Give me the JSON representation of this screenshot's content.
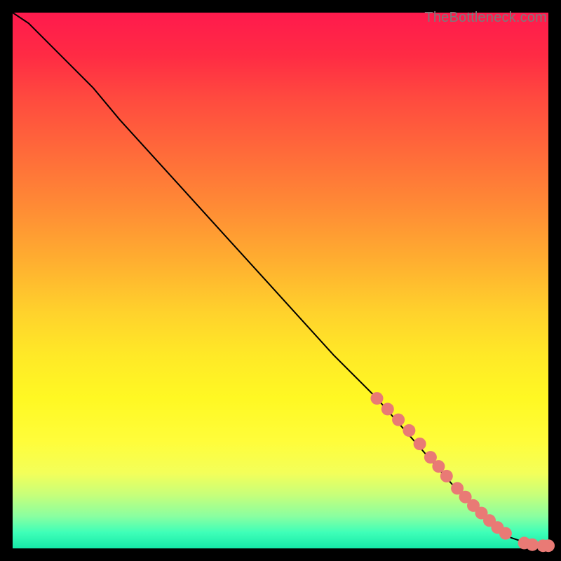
{
  "watermark": "TheBottleneck.com",
  "chart_data": {
    "type": "line",
    "title": "",
    "xlabel": "",
    "ylabel": "",
    "xlim": [
      0,
      100
    ],
    "ylim": [
      0,
      100
    ],
    "series": [
      {
        "name": "curve",
        "x": [
          0,
          3,
          6,
          10,
          15,
          20,
          30,
          40,
          50,
          60,
          68,
          75,
          82,
          87,
          90,
          93,
          96,
          98,
          100
        ],
        "y": [
          100,
          98,
          95,
          91,
          86,
          80,
          69,
          58,
          47,
          36,
          28,
          20,
          12,
          7,
          4,
          2,
          1,
          0.5,
          0.5
        ]
      }
    ],
    "markers": [
      {
        "name": "points-on-curve",
        "color": "#e97a75",
        "radius_px": 9,
        "x": [
          68,
          70,
          72,
          74,
          76,
          78,
          79.5,
          81,
          83,
          84.5,
          86,
          87.5,
          89,
          90.5,
          92,
          95.5,
          97,
          99,
          100
        ],
        "y": [
          28,
          26,
          24,
          22,
          19.5,
          17,
          15.3,
          13.5,
          11.2,
          9.6,
          8.0,
          6.6,
          5.2,
          3.9,
          2.8,
          1.0,
          0.7,
          0.5,
          0.5
        ]
      }
    ]
  }
}
